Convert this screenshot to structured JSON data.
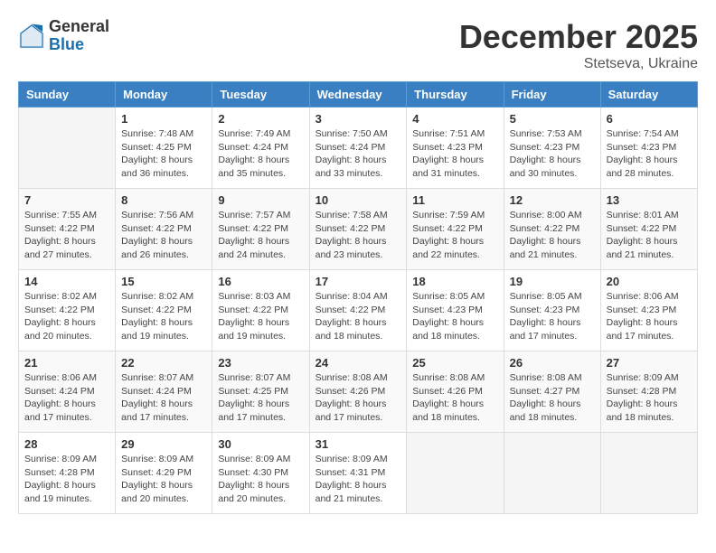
{
  "logo": {
    "general": "General",
    "blue": "Blue"
  },
  "header": {
    "month": "December 2025",
    "location": "Stetseva, Ukraine"
  },
  "weekdays": [
    "Sunday",
    "Monday",
    "Tuesday",
    "Wednesday",
    "Thursday",
    "Friday",
    "Saturday"
  ],
  "weeks": [
    [
      {
        "day": "",
        "info": ""
      },
      {
        "day": "1",
        "info": "Sunrise: 7:48 AM\nSunset: 4:25 PM\nDaylight: 8 hours\nand 36 minutes."
      },
      {
        "day": "2",
        "info": "Sunrise: 7:49 AM\nSunset: 4:24 PM\nDaylight: 8 hours\nand 35 minutes."
      },
      {
        "day": "3",
        "info": "Sunrise: 7:50 AM\nSunset: 4:24 PM\nDaylight: 8 hours\nand 33 minutes."
      },
      {
        "day": "4",
        "info": "Sunrise: 7:51 AM\nSunset: 4:23 PM\nDaylight: 8 hours\nand 31 minutes."
      },
      {
        "day": "5",
        "info": "Sunrise: 7:53 AM\nSunset: 4:23 PM\nDaylight: 8 hours\nand 30 minutes."
      },
      {
        "day": "6",
        "info": "Sunrise: 7:54 AM\nSunset: 4:23 PM\nDaylight: 8 hours\nand 28 minutes."
      }
    ],
    [
      {
        "day": "7",
        "info": "Sunrise: 7:55 AM\nSunset: 4:22 PM\nDaylight: 8 hours\nand 27 minutes."
      },
      {
        "day": "8",
        "info": "Sunrise: 7:56 AM\nSunset: 4:22 PM\nDaylight: 8 hours\nand 26 minutes."
      },
      {
        "day": "9",
        "info": "Sunrise: 7:57 AM\nSunset: 4:22 PM\nDaylight: 8 hours\nand 24 minutes."
      },
      {
        "day": "10",
        "info": "Sunrise: 7:58 AM\nSunset: 4:22 PM\nDaylight: 8 hours\nand 23 minutes."
      },
      {
        "day": "11",
        "info": "Sunrise: 7:59 AM\nSunset: 4:22 PM\nDaylight: 8 hours\nand 22 minutes."
      },
      {
        "day": "12",
        "info": "Sunrise: 8:00 AM\nSunset: 4:22 PM\nDaylight: 8 hours\nand 21 minutes."
      },
      {
        "day": "13",
        "info": "Sunrise: 8:01 AM\nSunset: 4:22 PM\nDaylight: 8 hours\nand 21 minutes."
      }
    ],
    [
      {
        "day": "14",
        "info": "Sunrise: 8:02 AM\nSunset: 4:22 PM\nDaylight: 8 hours\nand 20 minutes."
      },
      {
        "day": "15",
        "info": "Sunrise: 8:02 AM\nSunset: 4:22 PM\nDaylight: 8 hours\nand 19 minutes."
      },
      {
        "day": "16",
        "info": "Sunrise: 8:03 AM\nSunset: 4:22 PM\nDaylight: 8 hours\nand 19 minutes."
      },
      {
        "day": "17",
        "info": "Sunrise: 8:04 AM\nSunset: 4:22 PM\nDaylight: 8 hours\nand 18 minutes."
      },
      {
        "day": "18",
        "info": "Sunrise: 8:05 AM\nSunset: 4:23 PM\nDaylight: 8 hours\nand 18 minutes."
      },
      {
        "day": "19",
        "info": "Sunrise: 8:05 AM\nSunset: 4:23 PM\nDaylight: 8 hours\nand 17 minutes."
      },
      {
        "day": "20",
        "info": "Sunrise: 8:06 AM\nSunset: 4:23 PM\nDaylight: 8 hours\nand 17 minutes."
      }
    ],
    [
      {
        "day": "21",
        "info": "Sunrise: 8:06 AM\nSunset: 4:24 PM\nDaylight: 8 hours\nand 17 minutes."
      },
      {
        "day": "22",
        "info": "Sunrise: 8:07 AM\nSunset: 4:24 PM\nDaylight: 8 hours\nand 17 minutes."
      },
      {
        "day": "23",
        "info": "Sunrise: 8:07 AM\nSunset: 4:25 PM\nDaylight: 8 hours\nand 17 minutes."
      },
      {
        "day": "24",
        "info": "Sunrise: 8:08 AM\nSunset: 4:26 PM\nDaylight: 8 hours\nand 17 minutes."
      },
      {
        "day": "25",
        "info": "Sunrise: 8:08 AM\nSunset: 4:26 PM\nDaylight: 8 hours\nand 18 minutes."
      },
      {
        "day": "26",
        "info": "Sunrise: 8:08 AM\nSunset: 4:27 PM\nDaylight: 8 hours\nand 18 minutes."
      },
      {
        "day": "27",
        "info": "Sunrise: 8:09 AM\nSunset: 4:28 PM\nDaylight: 8 hours\nand 18 minutes."
      }
    ],
    [
      {
        "day": "28",
        "info": "Sunrise: 8:09 AM\nSunset: 4:28 PM\nDaylight: 8 hours\nand 19 minutes."
      },
      {
        "day": "29",
        "info": "Sunrise: 8:09 AM\nSunset: 4:29 PM\nDaylight: 8 hours\nand 20 minutes."
      },
      {
        "day": "30",
        "info": "Sunrise: 8:09 AM\nSunset: 4:30 PM\nDaylight: 8 hours\nand 20 minutes."
      },
      {
        "day": "31",
        "info": "Sunrise: 8:09 AM\nSunset: 4:31 PM\nDaylight: 8 hours\nand 21 minutes."
      },
      {
        "day": "",
        "info": ""
      },
      {
        "day": "",
        "info": ""
      },
      {
        "day": "",
        "info": ""
      }
    ]
  ]
}
